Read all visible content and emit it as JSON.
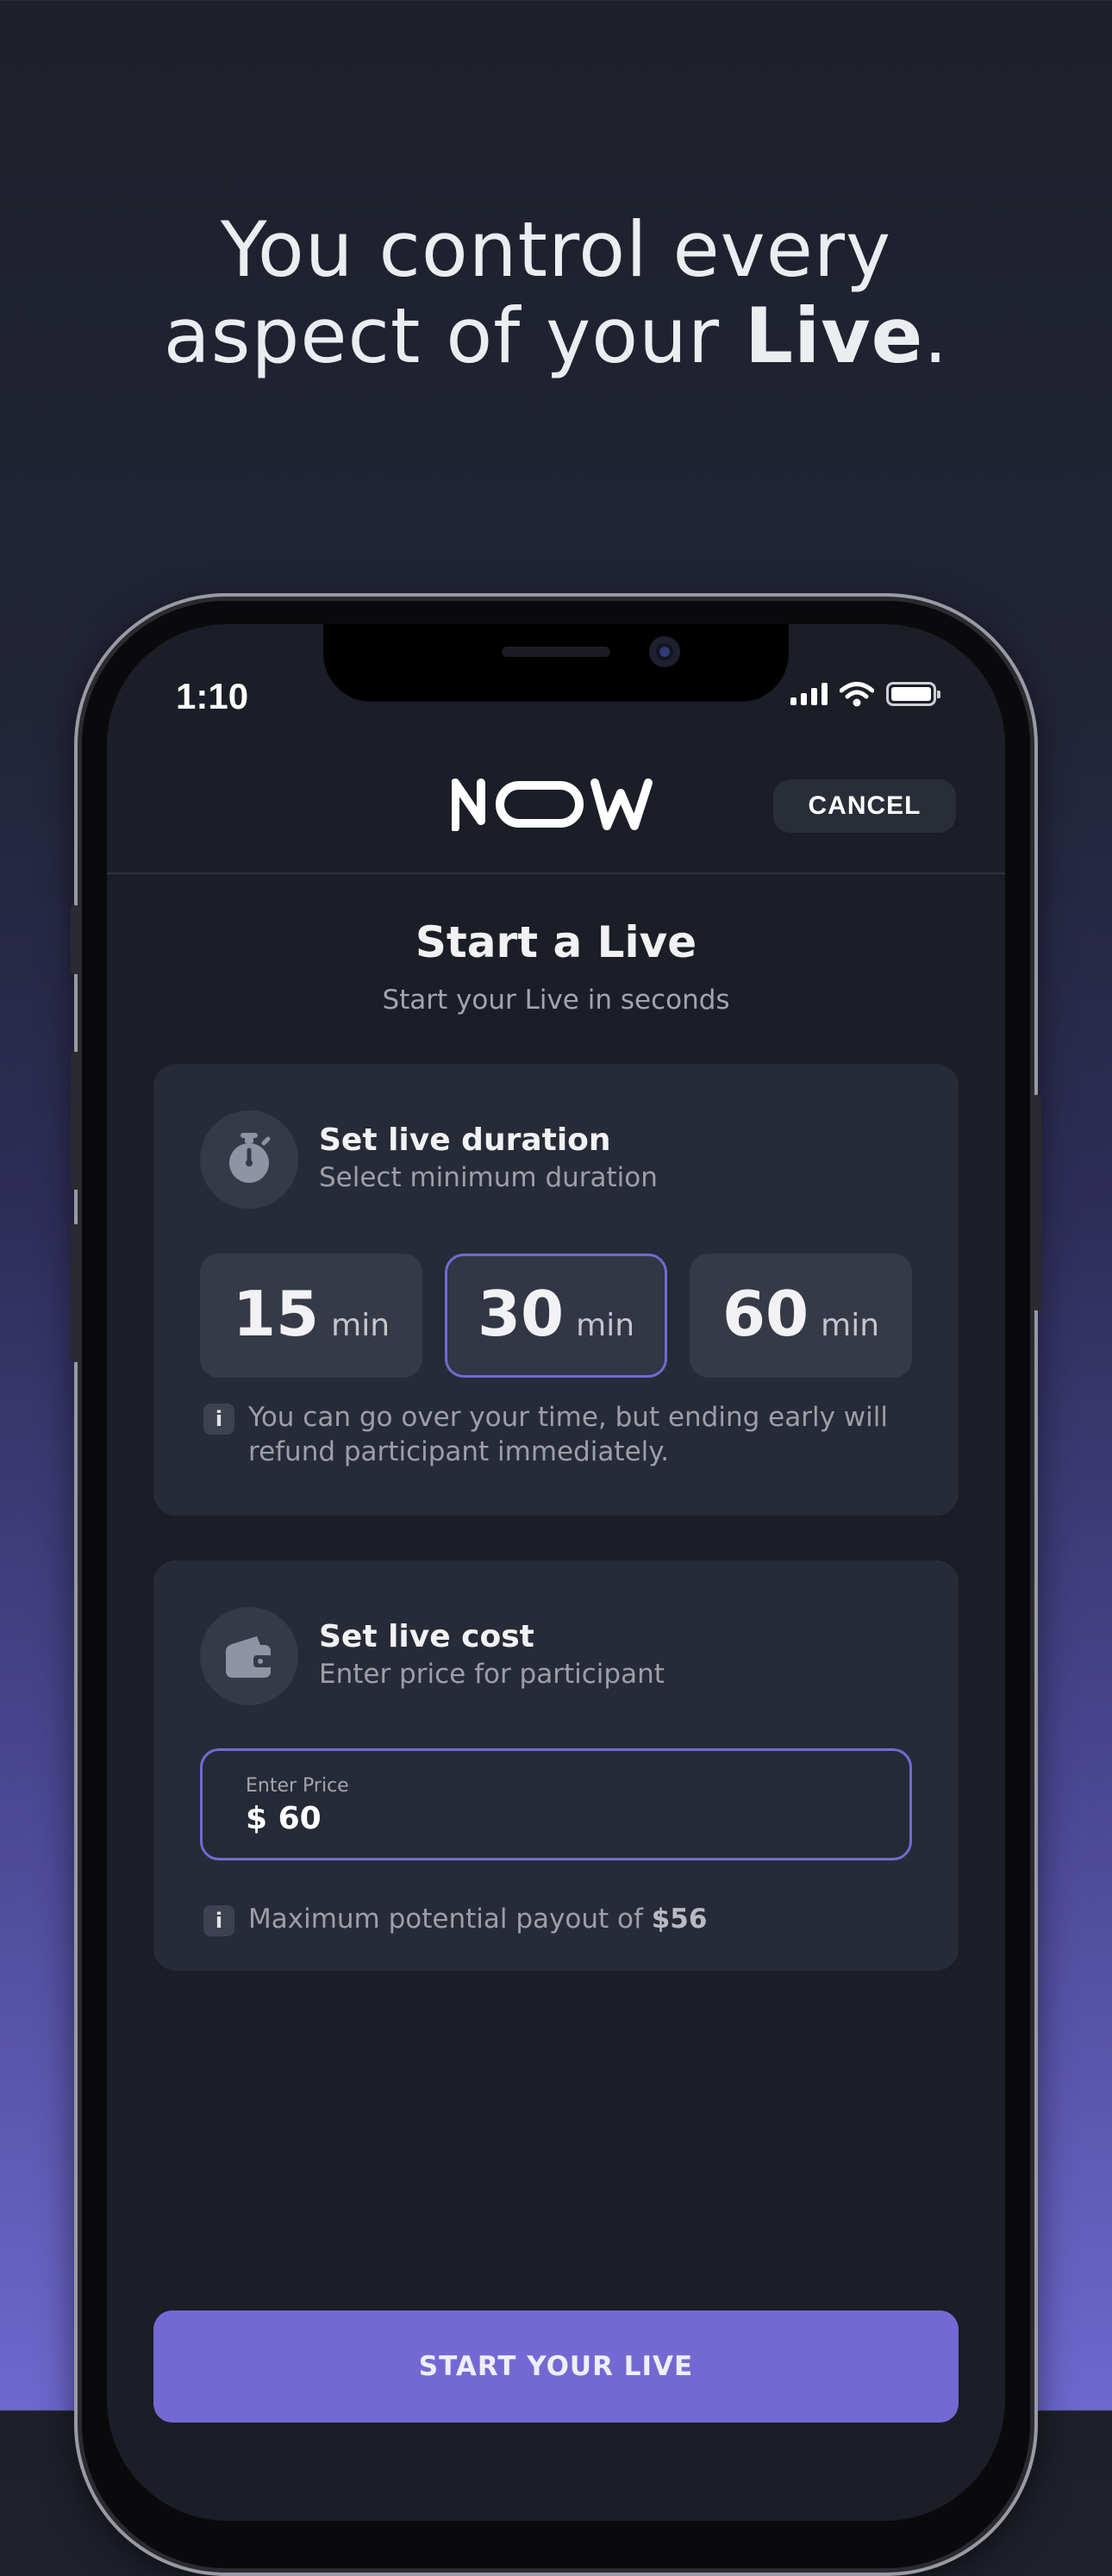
{
  "headline": {
    "line1": "You control every",
    "line2_prefix": "aspect of your ",
    "line2_bold": "Live",
    "line2_suffix": "."
  },
  "status_bar": {
    "time": "1:10",
    "icons": [
      "signal-icon",
      "wifi-icon",
      "battery-icon"
    ]
  },
  "nav": {
    "logo_text": "NOW",
    "cancel_label": "CANCEL"
  },
  "page": {
    "title": "Start a Live",
    "subtitle": "Start your Live in seconds"
  },
  "duration_card": {
    "icon": "stopwatch-icon",
    "title": "Set live duration",
    "subtitle": "Select minimum duration",
    "options": [
      {
        "value": "15",
        "unit": "min",
        "selected": false
      },
      {
        "value": "30",
        "unit": "min",
        "selected": true
      },
      {
        "value": "60",
        "unit": "min",
        "selected": false
      }
    ],
    "info_icon": "i",
    "info_line1": "You can go over your time, but ending early will",
    "info_line2": "refund participant immediately."
  },
  "cost_card": {
    "icon": "wallet-icon",
    "title": "Set live cost",
    "subtitle": "Enter price for participant",
    "price_label": "Enter Price",
    "price_value": "$ 60",
    "info_icon": "i",
    "payout_prefix": "Maximum potential payout of ",
    "payout_amount": "$56"
  },
  "start_button": {
    "label": "START YOUR LIVE"
  },
  "colors": {
    "accent": "#7469d3",
    "background": "#1b1e26",
    "card": "#272b37"
  }
}
